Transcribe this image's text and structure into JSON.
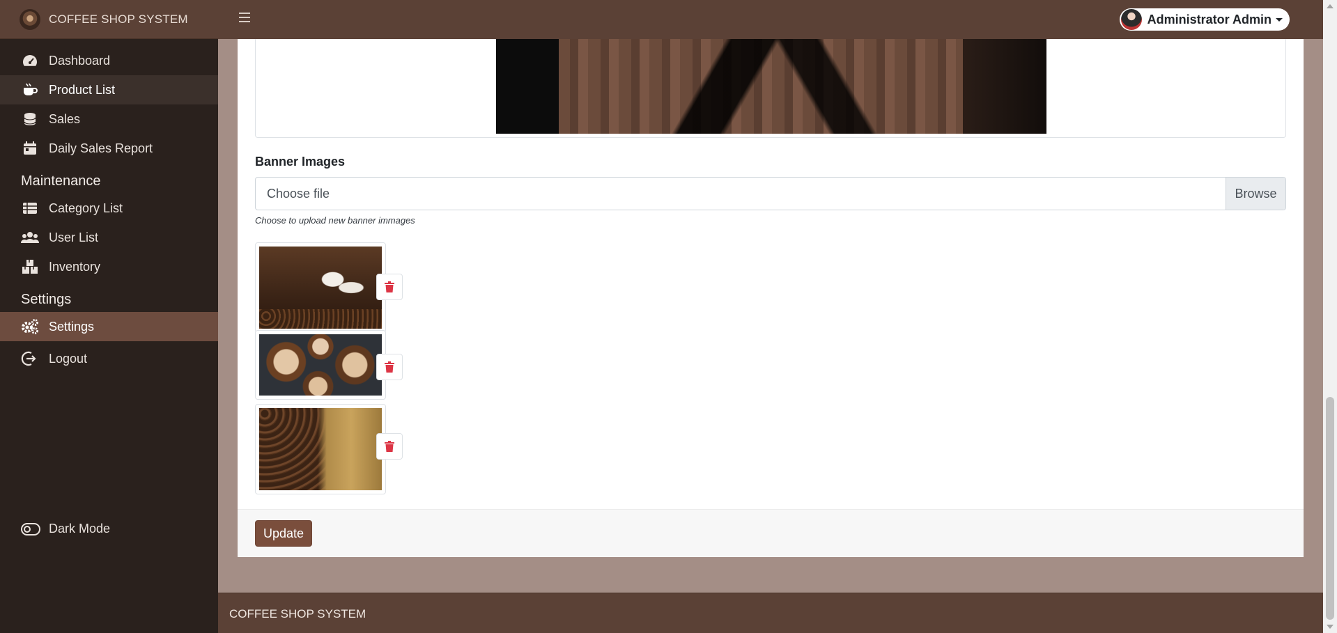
{
  "app": {
    "title": "COFFEE SHOP SYSTEM"
  },
  "sidebar": {
    "items": [
      {
        "label": "Dashboard",
        "icon": "dashboard-gauge-icon"
      },
      {
        "label": "Product List",
        "icon": "coffee-cup-icon"
      },
      {
        "label": "Sales",
        "icon": "coins-stack-icon"
      },
      {
        "label": "Daily Sales Report",
        "icon": "calendar-icon"
      }
    ],
    "maintenance_header": "Maintenance",
    "maintenance_items": [
      {
        "label": "Category List",
        "icon": "table-list-icon"
      },
      {
        "label": "User List",
        "icon": "users-icon"
      },
      {
        "label": "Inventory",
        "icon": "boxes-icon"
      }
    ],
    "settings_header": "Settings",
    "settings_items": [
      {
        "label": "Settings",
        "icon": "gears-icon"
      },
      {
        "label": "Logout",
        "icon": "logout-icon"
      }
    ],
    "dark_mode_label": "Dark Mode"
  },
  "topbar": {
    "user_name": "Administrator Admin"
  },
  "form": {
    "banner_label": "Banner Images",
    "file_placeholder": "Choose file",
    "browse_label": "Browse",
    "help_text": "Choose to upload new banner immages",
    "update_label": "Update"
  },
  "footer": {
    "text": "COFFEE SHOP SYSTEM"
  },
  "colors": {
    "accent": "#7a4e3c",
    "header": "#5b4136",
    "sidebar": "#2a211d",
    "danger": "#dc3545"
  }
}
